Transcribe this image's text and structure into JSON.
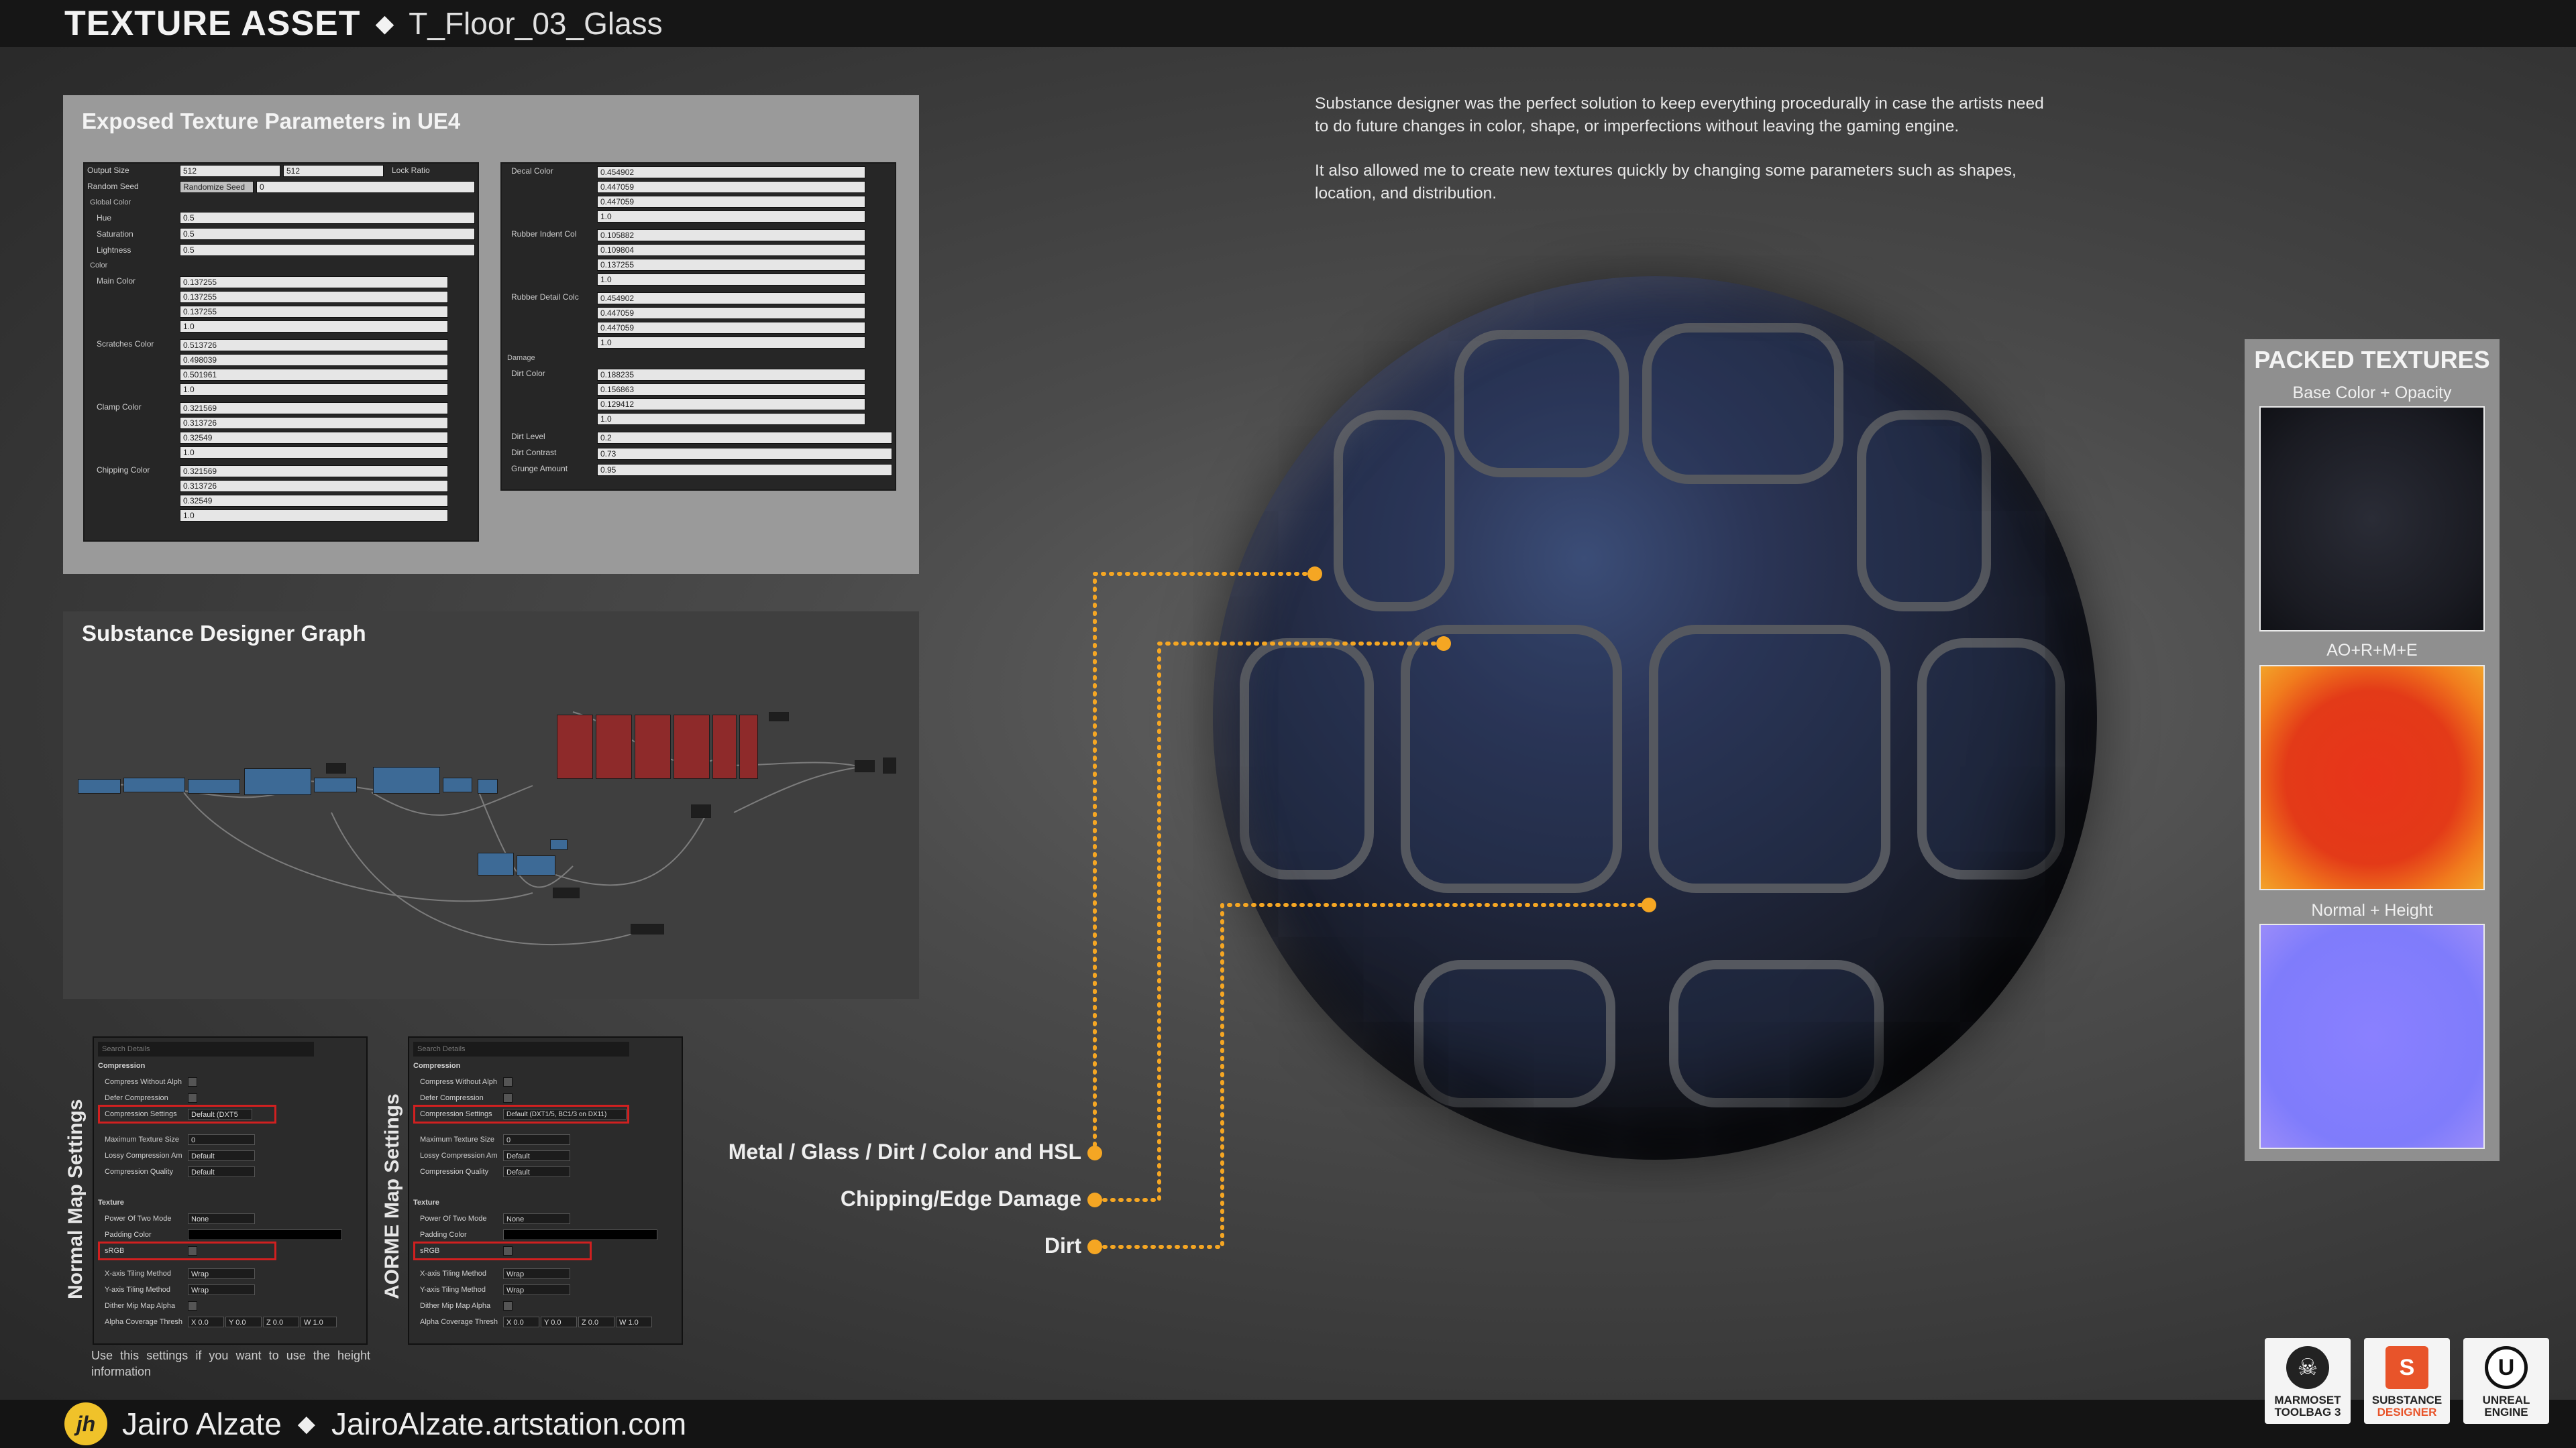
{
  "header": {
    "title": "TEXTURE ASSET",
    "separator": "◆",
    "subtitle": "T_Floor_03_Glass"
  },
  "footer": {
    "logo_text": "jh",
    "name": "Jairo Alzate",
    "separator": "◆",
    "url": "JairoAlzate.artstation.com"
  },
  "logos": [
    {
      "name": "marmoset",
      "line1": "MARMOSET",
      "line2": "TOOLBAG 3"
    },
    {
      "name": "substance",
      "line1": "SUBSTANCE",
      "line2": "DESIGNER"
    },
    {
      "name": "unreal",
      "line1": "UNREAL",
      "line2": "ENGINE"
    }
  ],
  "params_panel": {
    "title": "Exposed Texture Parameters in UE4",
    "left_box": {
      "output_size_label": "Output Size",
      "output_size_a": "512",
      "output_size_b": "512",
      "lock_ratio": "Lock Ratio",
      "random_seed_label": "Random Seed",
      "randomize_button": "Randomize Seed",
      "random_seed_value": "0",
      "global_color": "Global Color",
      "hue_label": "Hue",
      "hue": "0.5",
      "saturation_label": "Saturation",
      "saturation": "0.5",
      "lightness_label": "Lightness",
      "lightness": "0.5",
      "color_section": "Color",
      "main_color_label": "Main Color",
      "main_color": [
        "0.137255",
        "0.137255",
        "0.137255",
        "1.0"
      ],
      "scratches_label": "Scratches Color",
      "scratches_color": [
        "0.513726",
        "0.498039",
        "0.501961",
        "1.0"
      ],
      "clamp_label": "Clamp Color",
      "clamp_color": [
        "0.321569",
        "0.313726",
        "0.32549",
        "1.0"
      ],
      "chipping_label": "Chipping Color",
      "chipping_color": [
        "0.321569",
        "0.313726",
        "0.32549",
        "1.0"
      ]
    },
    "right_box": {
      "decal_label": "Decal Color",
      "decal_color": [
        "0.454902",
        "0.447059",
        "0.447059",
        "1.0"
      ],
      "rubber_indent_label": "Rubber Indent Col",
      "rubber_indent_color": [
        "0.105882",
        "0.109804",
        "0.137255",
        "1.0"
      ],
      "rubber_detail_label": "Rubber Detail Colc",
      "rubber_detail_color": [
        "0.454902",
        "0.447059",
        "0.447059",
        "1.0"
      ],
      "damage_section": "Damage",
      "dirt_color_label": "Dirt Color",
      "dirt_color": [
        "0.188235",
        "0.156863",
        "0.129412",
        "1.0"
      ],
      "dirt_level_label": "Dirt Level",
      "dirt_level": "0.2",
      "dirt_contrast_label": "Dirt Contrast",
      "dirt_contrast": "0.73",
      "grunge_label": "Grunge Amount",
      "grunge_amount": "0.95"
    }
  },
  "graph_panel": {
    "title": "Substance Designer Graph"
  },
  "settings_panels": [
    {
      "vertical_label": "Normal Map Settings",
      "search_placeholder": "Search Details",
      "compression": "Compression",
      "compress_without_alpha": "Compress Without Alph",
      "defer_compression": "Defer Compression",
      "compression_settings": "Compression Settings",
      "compression_value": "Default (DXT5",
      "max_texture_size": "Maximum Texture Size",
      "max_texture_value": "0",
      "lossy": "Lossy Compression Am",
      "lossy_value": "Default",
      "quality": "Compression Quality",
      "quality_value": "Default",
      "texture": "Texture",
      "power_of_two": "Power Of Two Mode",
      "power_value": "None",
      "padding": "Padding Color",
      "srgb": "sRGB",
      "x_tiling": "X-axis Tiling Method",
      "x_tiling_value": "Wrap",
      "y_tiling": "Y-axis Tiling Method",
      "y_tiling_value": "Wrap",
      "dither": "Dither Mip Map Alpha",
      "alpha_coverage": "Alpha Coverage Thresh",
      "coverage_values": [
        "X 0.0",
        "Y 0.0",
        "Z 0.0",
        "W 1.0"
      ]
    },
    {
      "vertical_label": "AORME Map Settings",
      "search_placeholder": "Search Details",
      "compression": "Compression",
      "compress_without_alpha": "Compress Without Alph",
      "defer_compression": "Defer Compression",
      "compression_settings": "Compression Settings",
      "compression_value": "Default (DXT1/5, BC1/3 on DX11)",
      "max_texture_size": "Maximum Texture Size",
      "max_texture_value": "0",
      "lossy": "Lossy Compression Am",
      "lossy_value": "Default",
      "quality": "Compression Quality",
      "quality_value": "Default",
      "texture": "Texture",
      "power_of_two": "Power Of Two Mode",
      "power_value": "None",
      "padding": "Padding Color",
      "srgb": "sRGB",
      "x_tiling": "X-axis Tiling Method",
      "x_tiling_value": "Wrap",
      "y_tiling": "Y-axis Tiling Method",
      "y_tiling_value": "Wrap",
      "dither": "Dither Mip Map Alpha",
      "alpha_coverage": "Alpha Coverage Thresh",
      "coverage_values": [
        "X 0.0",
        "Y 0.0",
        "Z 0.0",
        "W 1.0"
      ]
    }
  ],
  "settings_note": "Use this settings if you want to use the height information",
  "description": {
    "p1": "Substance designer was the perfect solution to keep everything procedurally in case the artists need to do future changes in color, shape, or imperfections without leaving the gaming engine.",
    "p2": "It also allowed me to create new textures quickly by changing some parameters such as shapes, location, and distribution."
  },
  "callouts": {
    "c1": "Metal / Glass / Dirt / Color and HSL",
    "c2": "Chipping/Edge Damage",
    "c3": "Dirt",
    "accent": "#f5a623"
  },
  "packed": {
    "title": "PACKED TEXTURES",
    "t1": "Base Color + Opacity",
    "t2": "AO+R+M+E",
    "t3": "Normal + Height"
  }
}
